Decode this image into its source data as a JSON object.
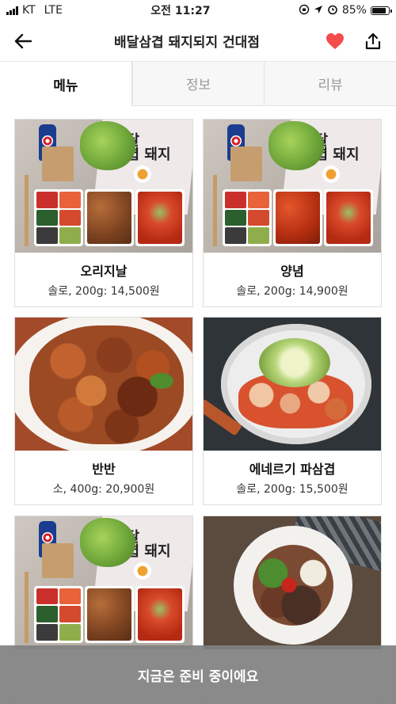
{
  "status": {
    "carrier": "KT",
    "network": "LTE",
    "time": "오전 11:27",
    "battery": "85%",
    "battery_level": 0.85
  },
  "header": {
    "title": "배달삼겹 돼지되지 건대점",
    "favorite_color": "#f44b4b"
  },
  "tabs": [
    {
      "label": "메뉴",
      "active": true
    },
    {
      "label": "정보",
      "active": false
    },
    {
      "label": "리뷰",
      "active": false
    }
  ],
  "menu": [
    {
      "name": "오리지날",
      "price": "솔로, 200g: 14,500원",
      "image": "bento-original"
    },
    {
      "name": "양념",
      "price": "솔로, 200g: 14,900원",
      "image": "bento-spicy"
    },
    {
      "name": "반반",
      "price": "소, 400g: 20,900원",
      "image": "meat-platter"
    },
    {
      "name": "에네르기 파삼겹",
      "price": "솔로, 200g: 15,500원",
      "image": "pan-dish"
    },
    {
      "name": "",
      "price": "",
      "image": "bento-original"
    },
    {
      "name": "",
      "price": "",
      "image": "bowl-noodles"
    }
  ],
  "bottom_notice": "지금은 준비 중이에요"
}
